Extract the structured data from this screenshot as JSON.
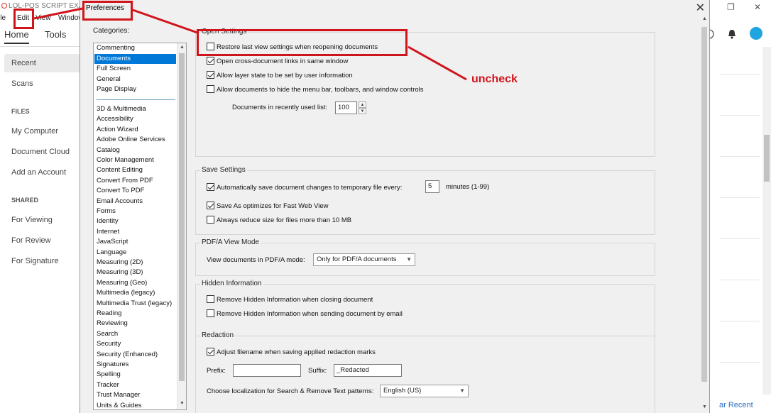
{
  "app": {
    "title": "LOL-POS SCRIPT EXAMP",
    "menu": [
      "File",
      "Edit",
      "View",
      "Window"
    ],
    "tabs": [
      "Home",
      "Tools"
    ],
    "nav": {
      "recent": "Recent",
      "scans": "Scans",
      "files_header": "FILES",
      "my_computer": "My Computer",
      "document_cloud": "Document Cloud",
      "add_account": "Add an Account",
      "shared_header": "SHARED",
      "for_viewing": "For Viewing",
      "for_review": "For Review",
      "for_signature": "For Signature"
    },
    "clear_recent": "ar Recent"
  },
  "dialog": {
    "title": "Preferences",
    "close_glyph": "✕",
    "categories_label": "Categories:",
    "categories_top": [
      "Commenting",
      "Documents",
      "Full Screen",
      "General",
      "Page Display"
    ],
    "categories": [
      "3D & Multimedia",
      "Accessibility",
      "Action Wizard",
      "Adobe Online Services",
      "Catalog",
      "Color Management",
      "Content Editing",
      "Convert From PDF",
      "Convert To PDF",
      "Email Accounts",
      "Forms",
      "Identity",
      "Internet",
      "JavaScript",
      "Language",
      "Measuring (2D)",
      "Measuring (3D)",
      "Measuring (Geo)",
      "Multimedia (legacy)",
      "Multimedia Trust (legacy)",
      "Reading",
      "Reviewing",
      "Search",
      "Security",
      "Security (Enhanced)",
      "Signatures",
      "Spelling",
      "Tracker",
      "Trust Manager",
      "Units & Guides"
    ],
    "selected_category": "Documents"
  },
  "open_settings": {
    "title": "Open Settings",
    "restore_last_view": {
      "label": "Restore last view settings when reopening documents",
      "checked": false
    },
    "cross_doc_links": {
      "label": "Open cross-document links in same window",
      "checked": true
    },
    "layer_state": {
      "label": "Allow layer state to be set by user information",
      "checked": true
    },
    "hide_menu": {
      "label": "Allow documents to hide the menu bar, toolbars, and window controls",
      "checked": false
    },
    "recent_list_label": "Documents in recently used list:",
    "recent_list_value": "100"
  },
  "save_settings": {
    "title": "Save Settings",
    "autosave": {
      "label": "Automatically save document changes to temporary file every:",
      "checked": true
    },
    "autosave_minutes": "5",
    "autosave_unit": "minutes (1-99)",
    "fast_web_view": {
      "label": "Save As optimizes for Fast Web View",
      "checked": true
    },
    "reduce_size": {
      "label": "Always reduce size for files more than 10 MB",
      "checked": false
    }
  },
  "pdfa": {
    "title": "PDF/A View Mode",
    "label": "View documents in PDF/A mode:",
    "value": "Only for PDF/A documents"
  },
  "hidden_info": {
    "title": "Hidden Information",
    "on_close": {
      "label": "Remove Hidden Information when closing document",
      "checked": false
    },
    "on_email": {
      "label": "Remove Hidden Information when sending document by email",
      "checked": false
    }
  },
  "redaction": {
    "title": "Redaction",
    "adjust_filename": {
      "label": "Adjust filename when saving applied redaction marks",
      "checked": true
    },
    "prefix_label": "Prefix:",
    "prefix_value": "",
    "suffix_label": "Suffix:",
    "suffix_value": "_Redacted",
    "localization_label": "Choose localization for Search & Remove Text patterns:",
    "localization_value": "English (US)"
  },
  "annotation": {
    "text": "uncheck",
    "color": "#d0141c"
  }
}
